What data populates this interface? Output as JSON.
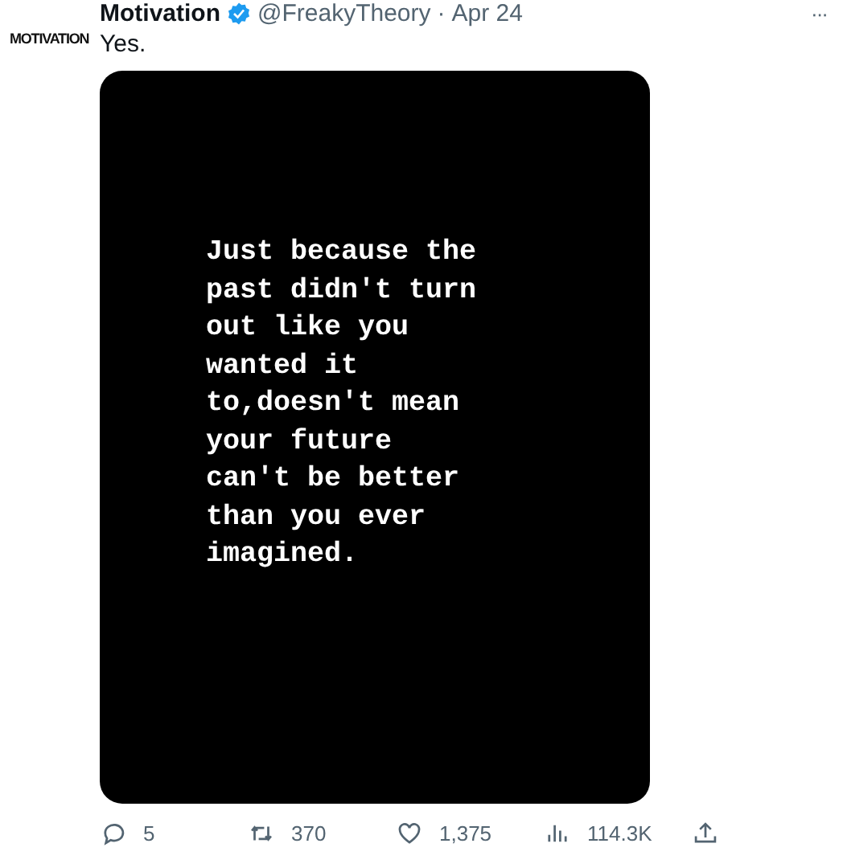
{
  "avatar": {
    "text": "MOTIVATION"
  },
  "author": {
    "name": "Motivation",
    "verified": true,
    "handle": "@FreakyTheory",
    "separator": "·",
    "date": "Apr 24"
  },
  "more": "···",
  "text": "Yes.",
  "media": {
    "lines": [
      "Just because the",
      "past didn't turn",
      "out like you",
      "wanted it",
      "to,doesn't mean",
      "your future",
      "can't be better",
      "than you ever",
      "imagined."
    ]
  },
  "actions": [
    {
      "kind": "reply",
      "count": "5"
    },
    {
      "kind": "repost",
      "count": "370"
    },
    {
      "kind": "like",
      "count": "1,375"
    },
    {
      "kind": "views",
      "count": "114.3K"
    },
    {
      "kind": "share"
    }
  ]
}
